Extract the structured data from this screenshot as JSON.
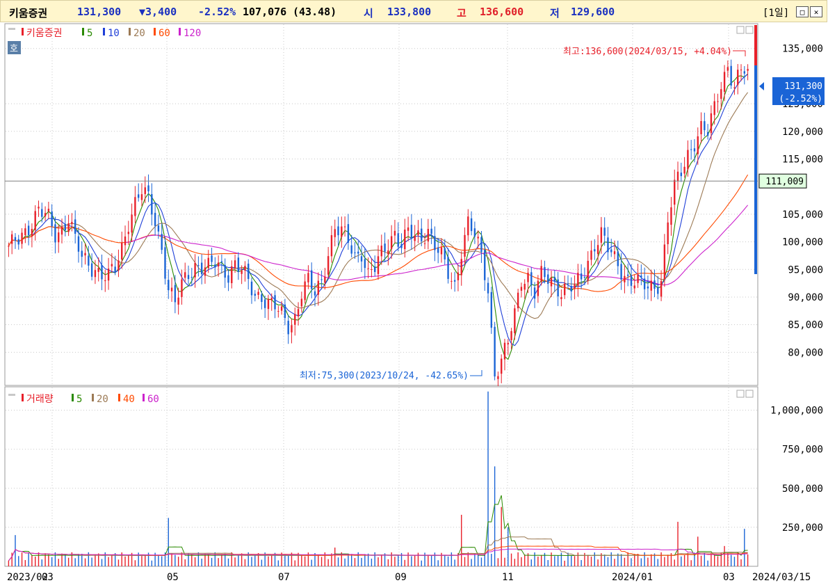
{
  "header": {
    "name": "키움증권",
    "price": "131,300",
    "change": "▼3,400",
    "change_pct": "-2.52%",
    "volume": "107,076",
    "volume_ratio": "(43.48)",
    "open_label": "시",
    "open": "133,800",
    "high_label": "고",
    "high": "136,600",
    "low_label": "저",
    "low": "129,600",
    "period": "[1일]"
  },
  "colors": {
    "up": "#e8202a",
    "down": "#1a64d6",
    "ma5": "#2a8a00",
    "ma10": "#1f3fd8",
    "ma20": "#9c7a55",
    "ma60": "#ff4a00",
    "ma120": "#cc22cc",
    "header_blue": "#1a30c0",
    "header_red": "#e0202a"
  },
  "price_panel": {
    "legend": [
      "키움증권",
      "5",
      "10",
      "20",
      "60",
      "120"
    ],
    "ho_label": "호",
    "high_annotation": "최고:136,600(2024/03/15, +4.04%)",
    "low_annotation": "최저:75,300(2023/10/24, -42.65%)",
    "current_label": "131,300",
    "current_pct": "(-2.52%)",
    "crosshair_label": "111,009"
  },
  "volume_panel": {
    "legend": [
      "거래량",
      "5",
      "20",
      "40",
      "60"
    ]
  },
  "chart_data": [
    {
      "type": "candlestick",
      "title": "키움증권",
      "y_ticks": [
        135000,
        125000,
        120000,
        115000,
        105000,
        100000,
        95000,
        90000,
        85000,
        80000
      ],
      "y_tick_labels": [
        "135,000",
        "125,000",
        "120,000",
        "115,000",
        "105,000",
        "100,000",
        "95,000",
        "90,000",
        "85,000",
        "80,000"
      ],
      "ylim": [
        74000,
        139500
      ],
      "x_tick_labels": [
        "2023/02",
        "03",
        "05",
        "07",
        "09",
        "11",
        "2024/01",
        "03",
        "2024/03/15"
      ],
      "close_path": [
        [
          0,
          98500
        ],
        [
          3,
          100500
        ],
        [
          6,
          103000
        ],
        [
          9,
          105500
        ],
        [
          12,
          104000
        ],
        [
          14,
          101500
        ],
        [
          16,
          102500
        ],
        [
          18,
          104500
        ],
        [
          20,
          100000
        ],
        [
          22,
          97000
        ],
        [
          24,
          96000
        ],
        [
          26,
          95500
        ],
        [
          28,
          94000
        ],
        [
          30,
          93500
        ],
        [
          32,
          95000
        ],
        [
          34,
          99000
        ],
        [
          36,
          104000
        ],
        [
          38,
          107000
        ],
        [
          40,
          109000
        ],
        [
          42,
          107500
        ],
        [
          44,
          104000
        ],
        [
          46,
          99000
        ],
        [
          48,
          91500
        ],
        [
          50,
          88500
        ],
        [
          52,
          92000
        ],
        [
          54,
          94500
        ],
        [
          56,
          96000
        ],
        [
          58,
          95500
        ],
        [
          60,
          95000
        ],
        [
          62,
          96000
        ],
        [
          64,
          95500
        ],
        [
          66,
          94500
        ],
        [
          68,
          96000
        ],
        [
          70,
          94500
        ],
        [
          72,
          92500
        ],
        [
          74,
          90500
        ],
        [
          76,
          90500
        ],
        [
          78,
          89000
        ],
        [
          80,
          88000
        ],
        [
          82,
          86500
        ],
        [
          84,
          85000
        ],
        [
          86,
          86500
        ],
        [
          88,
          91000
        ],
        [
          90,
          92500
        ],
        [
          92,
          90500
        ],
        [
          94,
          93000
        ],
        [
          96,
          98500
        ],
        [
          98,
          102500
        ],
        [
          100,
          101500
        ],
        [
          102,
          100000
        ],
        [
          104,
          97500
        ],
        [
          106,
          98500
        ],
        [
          108,
          94000
        ],
        [
          110,
          95000
        ],
        [
          112,
          97500
        ],
        [
          114,
          100000
        ],
        [
          116,
          102000
        ],
        [
          118,
          99500
        ],
        [
          120,
          101500
        ],
        [
          122,
          100500
        ],
        [
          124,
          101000
        ],
        [
          126,
          102500
        ],
        [
          128,
          99500
        ],
        [
          130,
          97000
        ],
        [
          132,
          94000
        ],
        [
          134,
          92000
        ],
        [
          136,
          99000
        ],
        [
          138,
          103500
        ],
        [
          140,
          101000
        ],
        [
          142,
          97000
        ],
        [
          144,
          91500
        ],
        [
          146,
          76500
        ],
        [
          148,
          78500
        ],
        [
          150,
          81500
        ],
        [
          152,
          86500
        ],
        [
          154,
          93500
        ],
        [
          156,
          94000
        ],
        [
          158,
          91000
        ],
        [
          160,
          93500
        ],
        [
          162,
          93000
        ],
        [
          164,
          92500
        ],
        [
          166,
          91500
        ],
        [
          168,
          92000
        ],
        [
          170,
          91500
        ],
        [
          172,
          93000
        ],
        [
          174,
          96500
        ],
        [
          176,
          100000
        ],
        [
          178,
          101500
        ],
        [
          180,
          98500
        ],
        [
          182,
          96500
        ],
        [
          184,
          95000
        ],
        [
          186,
          93500
        ],
        [
          188,
          93000
        ],
        [
          190,
          92000
        ],
        [
          192,
          91500
        ],
        [
          194,
          92000
        ],
        [
          196,
          93500
        ],
        [
          198,
          104000
        ],
        [
          200,
          109500
        ],
        [
          202,
          112500
        ],
        [
          204,
          116000
        ],
        [
          206,
          118500
        ],
        [
          208,
          120500
        ],
        [
          210,
          119500
        ],
        [
          212,
          124000
        ],
        [
          214,
          129000
        ],
        [
          216,
          132000
        ],
        [
          218,
          128000
        ],
        [
          220,
          130500
        ],
        [
          222,
          131300
        ]
      ],
      "ma_series": [
        {
          "name": "5",
          "lag": 4
        },
        {
          "name": "10",
          "lag": 7
        },
        {
          "name": "20",
          "lag": 14
        },
        {
          "name": "60",
          "lag": 36
        },
        {
          "name": "120",
          "lag": 55
        }
      ],
      "high_point": {
        "date": "2024/03/15",
        "value": 136600
      },
      "low_point": {
        "date": "2023/10/24",
        "value": 75300
      }
    },
    {
      "type": "bar",
      "title": "거래량",
      "y_ticks": [
        1000000,
        750000,
        500000,
        250000
      ],
      "y_tick_labels": [
        "1,000,000",
        "750,000",
        "500,000",
        "250,000"
      ],
      "ylim": [
        0,
        1150000
      ],
      "spikes": [
        {
          "bar": 2,
          "value": 200000
        },
        {
          "bar": 48,
          "value": 310000
        },
        {
          "bar": 98,
          "value": 120000
        },
        {
          "bar": 136,
          "value": 330000
        },
        {
          "bar": 144,
          "value": 1120000
        },
        {
          "bar": 146,
          "value": 640000
        },
        {
          "bar": 148,
          "value": 380000
        },
        {
          "bar": 150,
          "value": 250000
        },
        {
          "bar": 201,
          "value": 285000
        },
        {
          "bar": 207,
          "value": 190000
        },
        {
          "bar": 215,
          "value": 130000
        },
        {
          "bar": 221,
          "value": 240000
        }
      ],
      "base_volume": 60000
    }
  ]
}
